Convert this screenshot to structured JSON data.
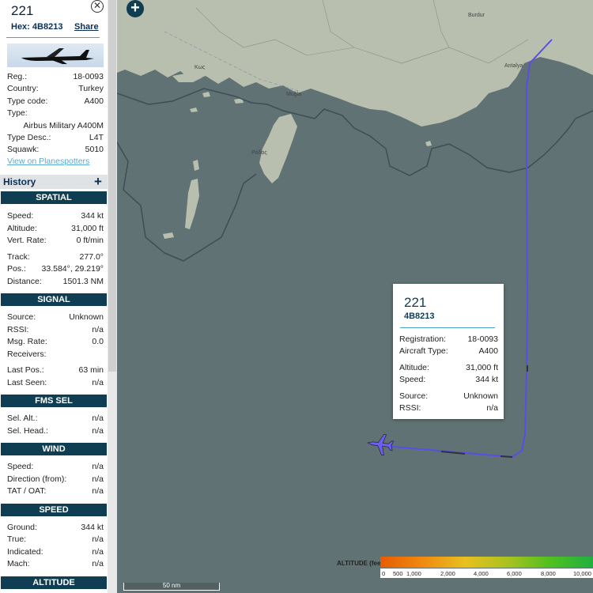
{
  "aircraft": {
    "callsign": "221",
    "hex_label": "Hex:",
    "hex": "4B8213",
    "share_label": "Share",
    "close_icon": "close-circle-icon",
    "details": [
      {
        "label": "Reg.:",
        "value": "18-0093"
      },
      {
        "label": "Country:",
        "value": "Turkey"
      },
      {
        "label": "Type code:",
        "value": "A400"
      },
      {
        "label": "Type:",
        "value": ""
      },
      {
        "label": "Type Desc.:",
        "value": "L4T"
      },
      {
        "label": "Squawk:",
        "value": "5010"
      }
    ],
    "type_full": "Airbus Military A400M",
    "planespotters_link": "View on Planespotters"
  },
  "history": {
    "label": "History",
    "plus_icon": "plus-icon"
  },
  "sections": {
    "spatial": {
      "title": "SPATIAL",
      "rows": [
        {
          "label": "Speed:",
          "value": "344 kt"
        },
        {
          "label": "Altitude:",
          "value": "31,000 ft"
        },
        {
          "label": "Vert. Rate:",
          "value": "0 ft/min"
        },
        {
          "label": "Track:",
          "value": "277.0°"
        },
        {
          "label": "Pos.:",
          "value": "33.584°, 29.219°"
        },
        {
          "label": "Distance:",
          "value": "1501.3 NM"
        }
      ]
    },
    "signal": {
      "title": "SIGNAL",
      "rows": [
        {
          "label": "Source:",
          "value": "Unknown"
        },
        {
          "label": "RSSI:",
          "value": "n/a"
        },
        {
          "label": "Msg. Rate:",
          "value": "0.0"
        },
        {
          "label": "Receivers:",
          "value": ""
        },
        {
          "label": "Last Pos.:",
          "value": "63 min"
        },
        {
          "label": "Last Seen:",
          "value": "n/a"
        }
      ]
    },
    "fms": {
      "title": "FMS SEL",
      "rows": [
        {
          "label": "Sel. Alt.:",
          "value": "n/a"
        },
        {
          "label": "Sel. Head.:",
          "value": "n/a"
        }
      ]
    },
    "wind": {
      "title": "WIND",
      "rows": [
        {
          "label": "Speed:",
          "value": "n/a"
        },
        {
          "label": "Direction (from):",
          "value": "n/a"
        },
        {
          "label": "TAT / OAT:",
          "value": "n/a"
        }
      ]
    },
    "speed": {
      "title": "SPEED",
      "rows": [
        {
          "label": "Ground:",
          "value": "344 kt"
        },
        {
          "label": "True:",
          "value": "n/a"
        },
        {
          "label": "Indicated:",
          "value": "n/a"
        },
        {
          "label": "Mach:",
          "value": "n/a"
        }
      ]
    },
    "altitude": {
      "title": "ALTITUDE"
    }
  },
  "popup": {
    "callsign": "221",
    "hex": "4B8213",
    "rows": [
      {
        "label": "Registration:",
        "value": "18-0093"
      },
      {
        "label": "Aircraft Type:",
        "value": "A400"
      },
      {
        "label": "Altitude:",
        "value": "31,000 ft"
      },
      {
        "label": "Speed:",
        "value": "344 kt"
      },
      {
        "label": "Source:",
        "value": "Unknown"
      },
      {
        "label": "RSSI:",
        "value": "n/a"
      }
    ]
  },
  "map": {
    "zoom_icon": "plus-icon",
    "scale_label": "50 nm",
    "place_labels": [
      "Muğla",
      "Antalya",
      "Ρόδος",
      "Κως",
      "Burdur"
    ],
    "legend": {
      "title": "ALTITUDE (feet)",
      "ticks": [
        "0",
        "500",
        "1,000",
        "2,000",
        "4,000",
        "6,000",
        "8,000",
        "10,000"
      ]
    },
    "colors": {
      "sea": "#607274",
      "land": "#b9bfae",
      "track": "#5a4ee6",
      "panel_header": "#0f3d52"
    }
  }
}
